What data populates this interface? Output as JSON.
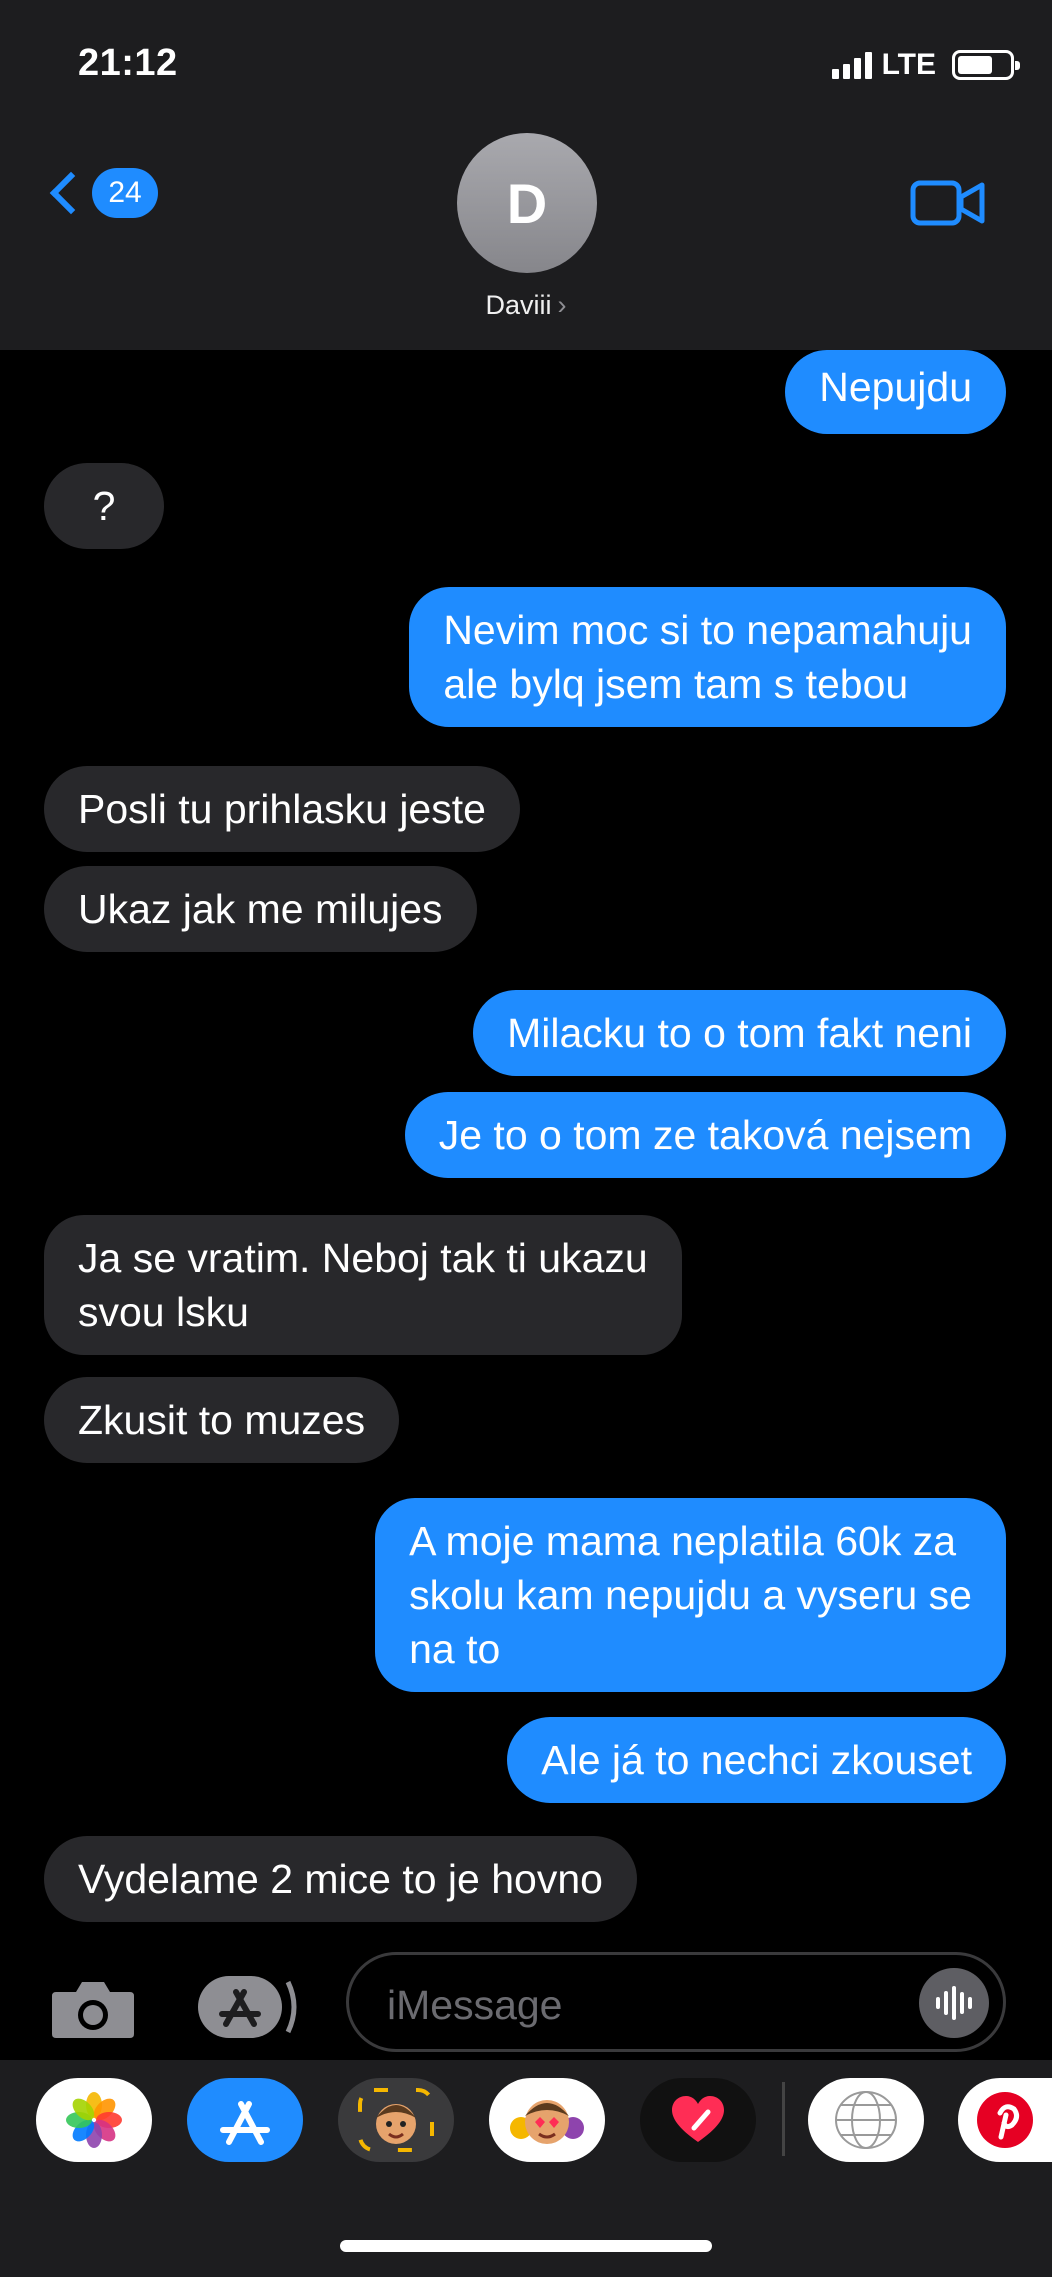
{
  "status": {
    "time": "21:12",
    "network": "LTE"
  },
  "header": {
    "back_count": "24",
    "avatar_letter": "D",
    "contact_name": "Daviii",
    "name_chevron": "›"
  },
  "messages": [
    {
      "from": "me",
      "text": "Nepujdu"
    },
    {
      "from": "them",
      "text": "?"
    },
    {
      "from": "me",
      "text": "Nevim moc si to nepamahuju\nale bylq jsem tam s tebou"
    },
    {
      "from": "them",
      "text": "Posli tu prihlasku jeste"
    },
    {
      "from": "them",
      "text": "Ukaz jak me milujes"
    },
    {
      "from": "me",
      "text": "Milacku to o tom fakt neni"
    },
    {
      "from": "me",
      "text": "Je to o tom ze taková nejsem"
    },
    {
      "from": "them",
      "text": "Ja se vratim. Neboj tak ti ukazu\nsvou lsku"
    },
    {
      "from": "them",
      "text": "Zkusit to muzes"
    },
    {
      "from": "me",
      "text": "A moje mama neplatila 60k za\nskolu kam nepujdu a vyseru se\nna to"
    },
    {
      "from": "me",
      "text": "Ale já to nechci zkouset"
    },
    {
      "from": "them",
      "text": "Vydelame 2 mice to je hovno"
    }
  ],
  "composer": {
    "placeholder": "iMessage"
  },
  "drawer": {
    "apps": [
      "photos-icon",
      "app-store-icon",
      "memoji-icon",
      "memoji-stickers-icon",
      "digital-touch-icon",
      "globe-search-icon",
      "pinterest-icon"
    ]
  },
  "colors": {
    "outgoing": "#1f8cff",
    "incoming": "#28282b",
    "background": "#000000",
    "header": "#1d1d1f"
  }
}
